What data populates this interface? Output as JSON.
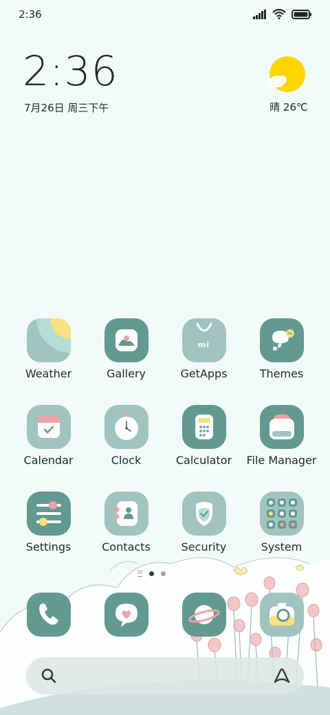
{
  "status_bar": {
    "time": "2:36"
  },
  "clock_widget": {
    "time": "2:36",
    "date": "7月26日 周三下午"
  },
  "weather_widget": {
    "text": "晴 26℃",
    "icon": "sunny-cloud-icon"
  },
  "apps": [
    {
      "label": "Weather",
      "icon": "weather-icon"
    },
    {
      "label": "Gallery",
      "icon": "gallery-icon"
    },
    {
      "label": "GetApps",
      "icon": "getapps-bag-icon"
    },
    {
      "label": "Themes",
      "icon": "themes-icon"
    },
    {
      "label": "Calendar",
      "icon": "calendar-icon"
    },
    {
      "label": "Clock",
      "icon": "clock-icon"
    },
    {
      "label": "Calculator",
      "icon": "calculator-icon"
    },
    {
      "label": "File Manager",
      "icon": "folder-icon"
    },
    {
      "label": "Settings",
      "icon": "settings-sliders-icon"
    },
    {
      "label": "Contacts",
      "icon": "contacts-icon"
    },
    {
      "label": "Security",
      "icon": "security-shield-icon"
    },
    {
      "label": "System",
      "icon": "system-folder-icon"
    }
  ],
  "getapps_logo": "mi",
  "page_indicator": {
    "pages": 2,
    "active": 1
  },
  "dock": [
    {
      "icon": "phone-icon"
    },
    {
      "icon": "messages-heart-icon"
    },
    {
      "icon": "browser-planet-icon"
    },
    {
      "icon": "camera-icon"
    }
  ],
  "search_bar": {
    "left_icon": "search-icon",
    "right_icon": "assistant-icon"
  },
  "colors": {
    "background": "#f2fbfa",
    "tile_dark": "#629a92",
    "tile_light": "#a1c4c0",
    "accent_pink": "#f2a1a6",
    "accent_yellow": "#f9e27a",
    "sun": "#ffd500"
  }
}
